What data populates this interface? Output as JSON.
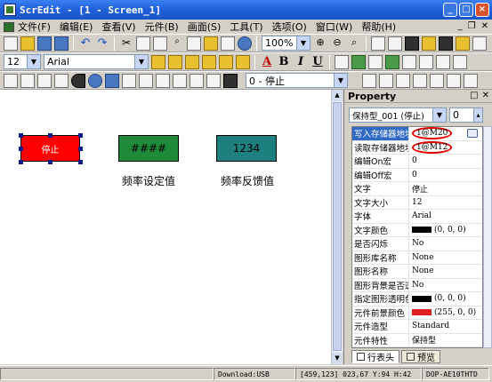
{
  "titlebar": {
    "title": "ScrEdit - [1 - Screen_1]"
  },
  "menubar": {
    "items": [
      "文件(F)",
      "编辑(E)",
      "查看(V)",
      "元件(B)",
      "画面(S)",
      "工具(T)",
      "选项(O)",
      "窗口(W)",
      "帮助(H)"
    ]
  },
  "toolbar1": {
    "zoom": "100%"
  },
  "toolbar2": {
    "font_size": "12",
    "font_name": "Arial"
  },
  "toolbar3": {
    "state": "0 - 停止"
  },
  "canvas": {
    "btn_label": "停止",
    "num1_text": "####",
    "num2_text": "1234",
    "num1_caption": "频率设定值",
    "num2_caption": "频率反馈值",
    "colors": {
      "btn": "#ff0000",
      "num1": "#1e8a3a",
      "num2": "#1e7f7f"
    }
  },
  "property": {
    "title": "Property",
    "object": "保持型_001 (停止)",
    "spin": "0",
    "rows": [
      {
        "k": "写入存储器地址",
        "v": "1@M20"
      },
      {
        "k": "读取存储器地址",
        "v": "1@M12"
      },
      {
        "k": "编辑On宏",
        "v": "0"
      },
      {
        "k": "编辑Off宏",
        "v": "0"
      },
      {
        "k": "文字",
        "v": "停止"
      },
      {
        "k": "文字大小",
        "v": "12"
      },
      {
        "k": "字体",
        "v": "Arial"
      },
      {
        "k": "文字颜色",
        "v": "(0, 0, 0)",
        "color": "#000000"
      },
      {
        "k": "是否闪烁",
        "v": "No"
      },
      {
        "k": "图形库名称",
        "v": "None"
      },
      {
        "k": "图形名称",
        "v": "None"
      },
      {
        "k": "图形背景是否透明",
        "v": "No"
      },
      {
        "k": "指定图形透明色",
        "v": "(0, 0, 0)",
        "color": "#000000"
      },
      {
        "k": "元件前景颜色",
        "v": "(255, 0, 0)",
        "color": "#e02020"
      },
      {
        "k": "元件造型",
        "v": "Standard"
      },
      {
        "k": "元件特性",
        "v": "保持型"
      }
    ],
    "tabs": [
      "行表头",
      "预览"
    ]
  },
  "status": {
    "download": "Download:USB",
    "coords": "[459,123] 023,67 Y:94 H:42",
    "model": "DOP-AE10THTD"
  }
}
